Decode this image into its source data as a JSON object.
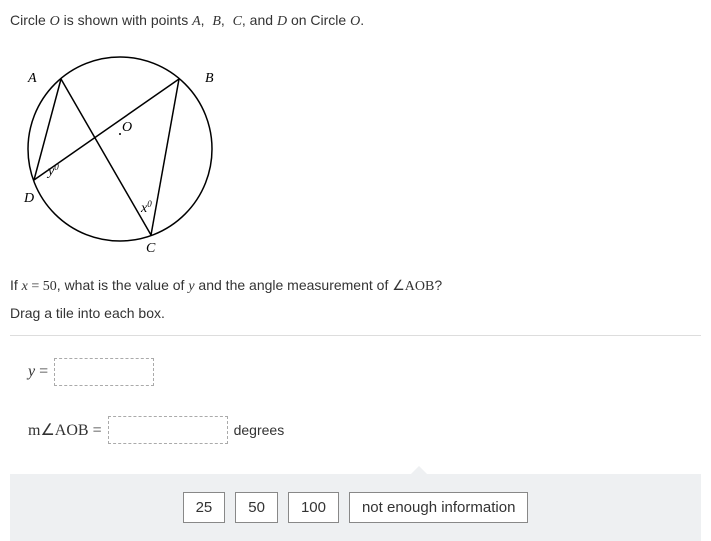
{
  "prompt": {
    "pre": "Circle ",
    "O1": "O",
    "mid": " is shown with points ",
    "A": "A",
    "c1": ", ",
    "B": "B",
    "c2": ", ",
    "C": "C",
    "c3": ", and ",
    "D": "D",
    "post": " on Circle ",
    "O2": "O",
    "end": "."
  },
  "diagram": {
    "labels": {
      "A": "A",
      "B": "B",
      "C": "C",
      "D": "D",
      "O": "O",
      "x": "x",
      "y": "y",
      "deg": "0"
    }
  },
  "question": {
    "pre": "If ",
    "x": "x",
    "eq": " = 50",
    "mid": ", what is the value of ",
    "y": "y",
    "mid2": " and the angle measurement of ",
    "angle": "∠AOB",
    "end": "?"
  },
  "instruction": "Drag a tile into each box.",
  "answers": {
    "row1_label_pre": "y",
    "row1_label_eq": " =",
    "row2_label_pre": "m∠AOB",
    "row2_label_eq": " =",
    "row2_unit": "degrees"
  },
  "tiles": [
    "25",
    "50",
    "100",
    "not enough information"
  ]
}
